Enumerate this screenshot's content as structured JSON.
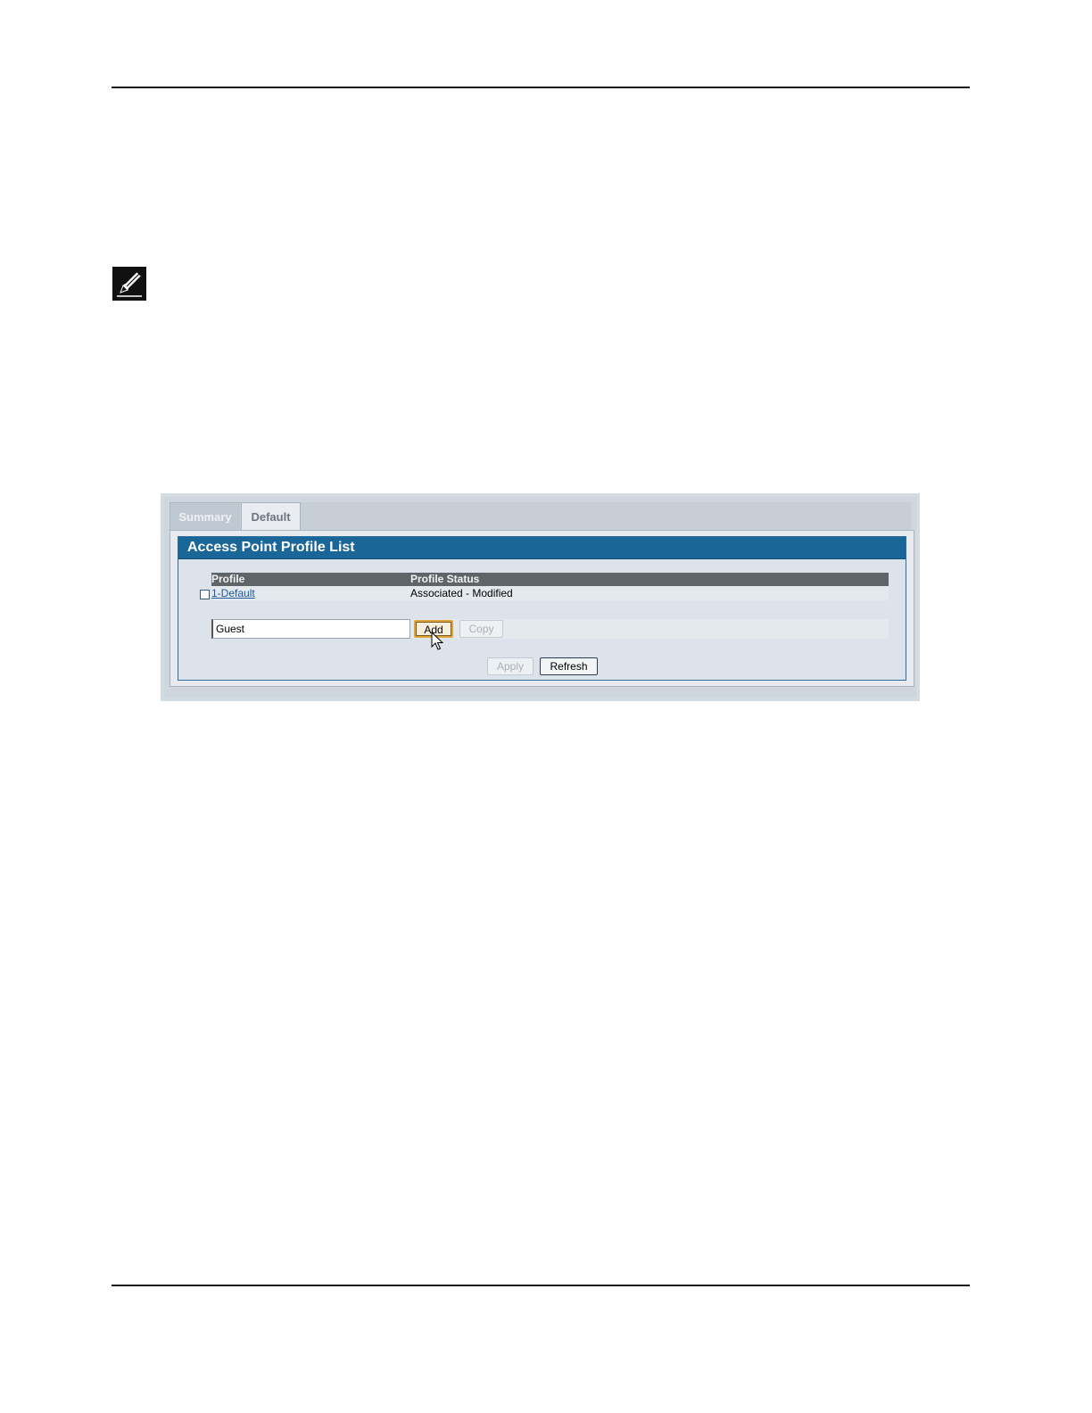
{
  "tabs": [
    {
      "label": "Summary"
    },
    {
      "label": "Default"
    }
  ],
  "panel": {
    "title": "Access Point Profile List"
  },
  "table": {
    "columns": [
      "Profile",
      "Profile Status"
    ],
    "rows": [
      {
        "profile": "1-Default",
        "status": "Associated - Modified",
        "checked": false
      }
    ]
  },
  "add_form": {
    "input_value": "Guest",
    "add_label": "Add",
    "copy_label": "Copy"
  },
  "actions": {
    "apply_label": "Apply",
    "refresh_label": "Refresh"
  },
  "colors": {
    "title_bar": "#1b6699",
    "header_bar": "#5e6468",
    "add_button_border": "#e0a43a"
  }
}
